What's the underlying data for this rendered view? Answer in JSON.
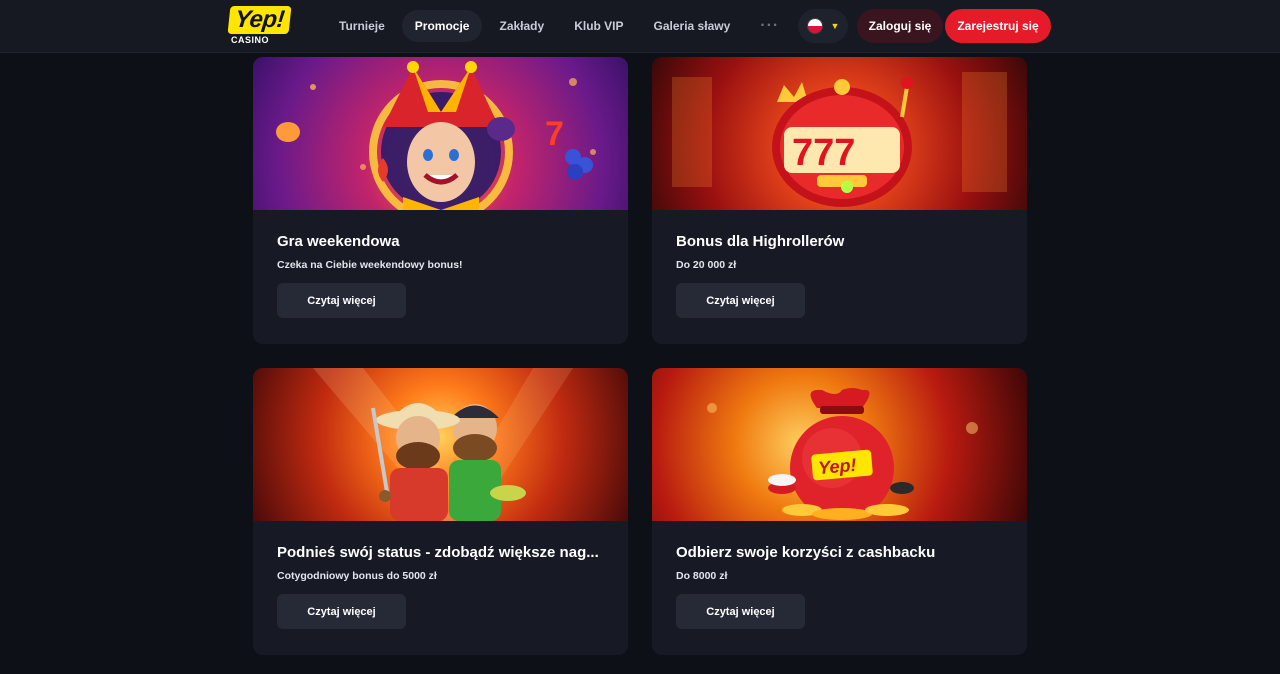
{
  "header": {
    "logo": {
      "text": "Yep!",
      "sub": "CASINO"
    },
    "nav": [
      {
        "label": "Turnieje",
        "active": false
      },
      {
        "label": "Promocje",
        "active": true
      },
      {
        "label": "Zakłady",
        "active": false
      },
      {
        "label": "Klub VIP",
        "active": false
      },
      {
        "label": "Galeria sławy",
        "active": false
      }
    ],
    "nav_more": "···",
    "language": {
      "flag": "pl-flag-icon"
    },
    "login_label": "Zaloguj się",
    "register_label": "Zarejestruj się"
  },
  "promotions": [
    {
      "title": "Gra weekendowa",
      "subtitle": "Czeka na Ciebie weekendowy bonus!",
      "button": "Czytaj więcej",
      "image": "joker-slot-image"
    },
    {
      "title": "Bonus dla Highrollerów",
      "subtitle": "Do 20 000 zł",
      "button": "Czytaj więcej",
      "image": "777-slot-machine-image"
    },
    {
      "title": "Podnieś swój status - zdobądź większe nag...",
      "subtitle": "Cotygodniowy bonus do 5000 zł",
      "button": "Czytaj więcej",
      "image": "cowboys-image"
    },
    {
      "title": "Odbierz swoje korzyści z cashbacku",
      "subtitle": "Do 8000 zł",
      "button": "Czytaj więcej",
      "image": "money-bag-image"
    }
  ],
  "colors": {
    "background": "#0e1018",
    "header": "#161922",
    "card": "#171a24",
    "accent_red": "#e51b2a",
    "logo_yellow": "#ffe600"
  }
}
